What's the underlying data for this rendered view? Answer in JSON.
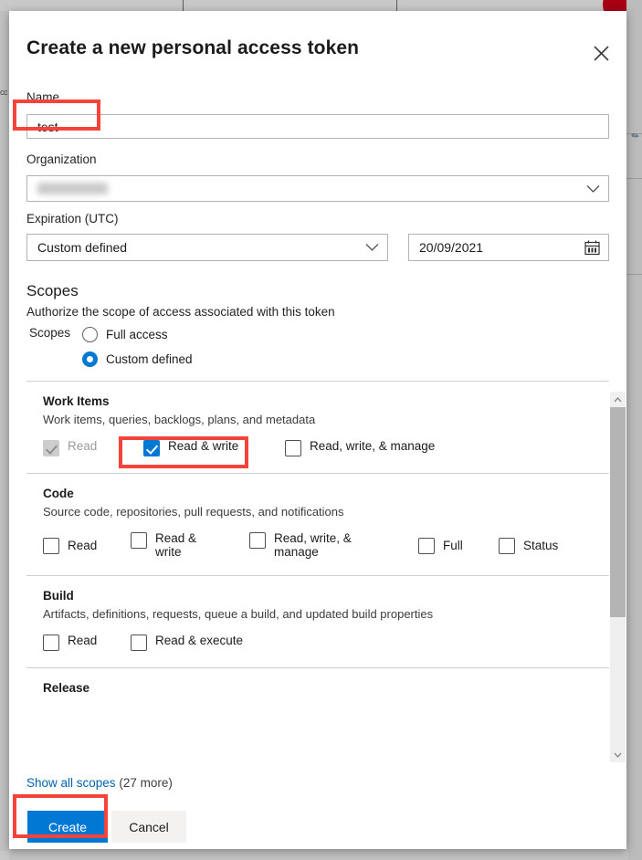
{
  "dialog": {
    "title": "Create a new personal access token",
    "close_icon": "close-icon"
  },
  "form": {
    "name": {
      "label": "Name",
      "value": "test",
      "placeholder": ""
    },
    "organization": {
      "label": "Organization",
      "value": "",
      "redacted": true,
      "chevron_icon": "chevron-down-icon"
    },
    "expiration": {
      "label": "Expiration (UTC)",
      "preset_value": "Custom defined",
      "date_value": "20/09/2021",
      "calendar_icon": "calendar-icon",
      "chevron_icon": "chevron-down-icon"
    }
  },
  "scopes": {
    "heading": "Scopes",
    "description": "Authorize the scope of access associated with this token",
    "radio_group_label": "Scopes",
    "options": [
      {
        "label": "Full access",
        "checked": false
      },
      {
        "label": "Custom defined",
        "checked": true
      }
    ],
    "groups": [
      {
        "title": "Work Items",
        "description": "Work items, queries, backlogs, plans, and metadata",
        "options": [
          {
            "label": "Read",
            "checked": true,
            "disabled": true
          },
          {
            "label": "Read & write",
            "checked": true,
            "disabled": false
          },
          {
            "label": "Read, write, & manage",
            "checked": false,
            "disabled": false
          }
        ]
      },
      {
        "title": "Code",
        "description": "Source code, repositories, pull requests, and notifications",
        "options": [
          {
            "label": "Read",
            "checked": false,
            "disabled": false
          },
          {
            "label": "Read & write",
            "checked": false,
            "disabled": false
          },
          {
            "label": "Read, write, & manage",
            "checked": false,
            "disabled": false
          },
          {
            "label": "Full",
            "checked": false,
            "disabled": false
          },
          {
            "label": "Status",
            "checked": false,
            "disabled": false
          }
        ]
      },
      {
        "title": "Build",
        "description": "Artifacts, definitions, requests, queue a build, and updated build properties",
        "options": [
          {
            "label": "Read",
            "checked": false,
            "disabled": false
          },
          {
            "label": "Read & execute",
            "checked": false,
            "disabled": false
          }
        ]
      },
      {
        "title": "Release",
        "description": "",
        "options": []
      }
    ],
    "scrollbar": {
      "up_icon": "chevron-up-icon",
      "down_icon": "chevron-down-icon"
    }
  },
  "footer": {
    "show_all_link": "Show all scopes",
    "show_all_count": "(27 more)",
    "create_label": "Create",
    "cancel_label": "Cancel"
  },
  "colors": {
    "accent": "#0078d4",
    "link": "#0362b0",
    "highlight": "#f4433a",
    "avatar": "#a80013"
  }
}
